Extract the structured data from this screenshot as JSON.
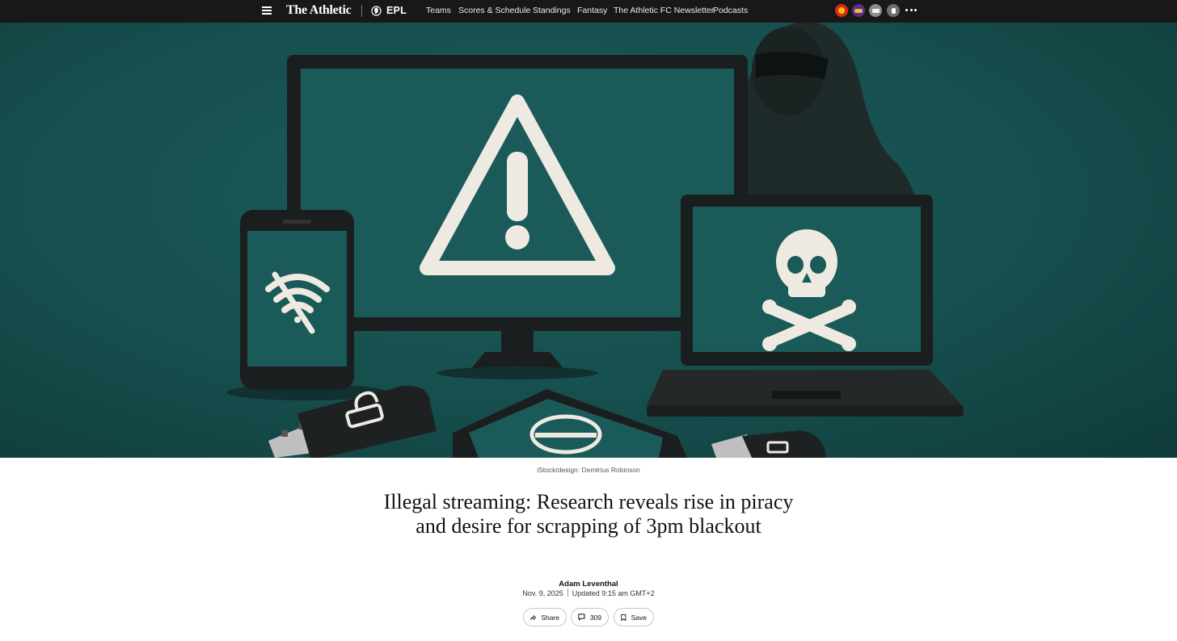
{
  "nav": {
    "brand": "The Athletic",
    "league": "EPL",
    "links": [
      "Teams",
      "Scores & Schedule",
      "Standings",
      "Fantasy",
      "The Athletic FC Newsletter",
      "Podcasts"
    ],
    "team_logos": [
      {
        "name": "manchester-united-logo",
        "color": "#da291c"
      },
      {
        "name": "liverpool-logo",
        "color": "#5b2d8a"
      },
      {
        "name": "arsenal-logo",
        "color": "#8c8c8c"
      },
      {
        "name": "tottenham-logo",
        "color": "#9a9a9a"
      }
    ]
  },
  "hero": {
    "caption": "iStock/design: Demtrius Robinson",
    "background_color": "#164f4e",
    "icons": [
      "warning-triangle-icon",
      "skull-crossbones-icon",
      "wifi-off-icon",
      "padlock-icon",
      "no-entry-icon",
      "hooded-figure"
    ]
  },
  "article": {
    "headline": "Illegal streaming: Research reveals rise in piracy and desire for scrapping of 3pm blackout",
    "author": "Adam Leventhal",
    "date": "Nov. 9, 2025",
    "updated": "Updated 9:15 am GMT+2"
  },
  "actions": {
    "share_label": "Share",
    "comments_count": "309",
    "save_label": "Save"
  }
}
